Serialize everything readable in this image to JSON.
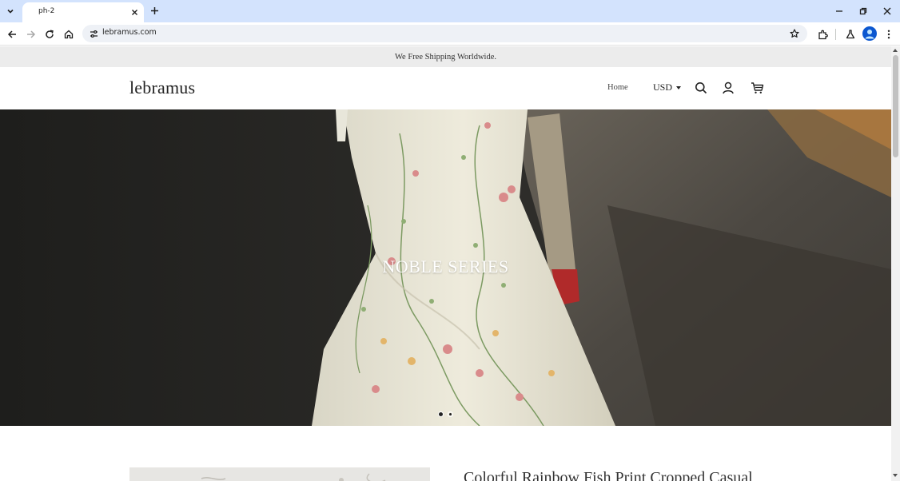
{
  "browser": {
    "tab_title": "ph-2",
    "url": "lebramus.com",
    "accent_color": "#d3e3fd"
  },
  "site": {
    "announcement": "We Free Shipping Worldwide.",
    "logo": "lebramus",
    "nav": {
      "home": "Home",
      "currency": "USD"
    },
    "hero": {
      "title": "NOBLE SERIES",
      "slide_count": 2,
      "active_slide": 1
    },
    "product": {
      "title": "Colorful Rainbow Fish Print Cropped Casual"
    }
  },
  "icons": [
    "chevron-down-icon",
    "close-icon",
    "plus-icon",
    "minimize-icon",
    "restore-icon",
    "back-icon",
    "forward-icon",
    "reload-icon",
    "home-icon",
    "site-info-icon",
    "star-icon",
    "extensions-icon",
    "labs-icon",
    "profile-icon",
    "more-icon",
    "search-icon",
    "account-icon",
    "cart-icon"
  ]
}
